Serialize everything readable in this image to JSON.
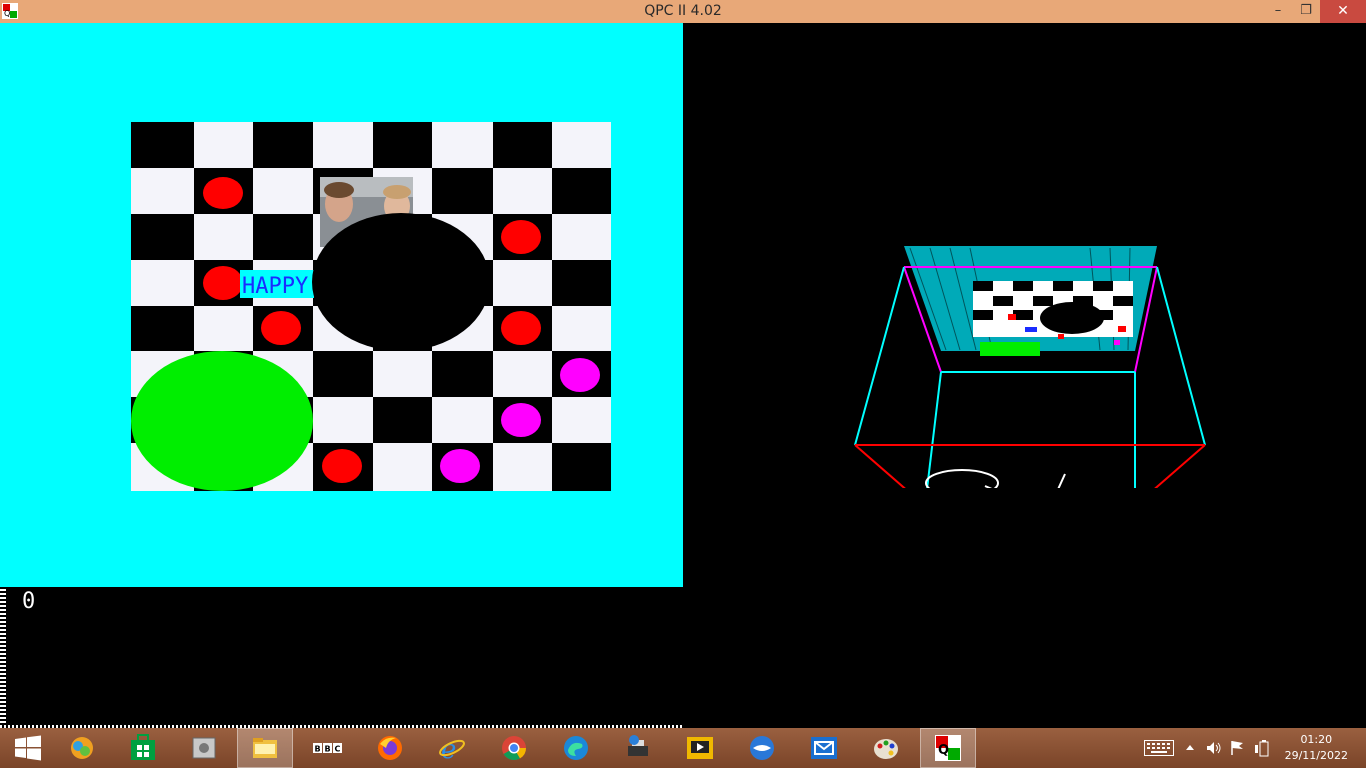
{
  "window": {
    "title": "QPC II 4.02",
    "minimize": "–",
    "restore": "❐",
    "close": "✕"
  },
  "board": {
    "happy_label": "HAPPY"
  },
  "console": {
    "line1": "0"
  },
  "scene3d": {
    "letters": "Q L"
  },
  "taskbar": {
    "apps": [
      "start",
      "photos",
      "store",
      "settings-tool",
      "file-explorer",
      "bbc",
      "firefox",
      "internet-explorer",
      "chrome",
      "edge",
      "printer-tool",
      "media-player",
      "thunderbird",
      "mail",
      "paint",
      "qpc"
    ],
    "bbc_label": "BBC",
    "active_app": "qpc"
  },
  "tray": {
    "time": "01:20",
    "date": "29/11/2022"
  },
  "colors": {
    "cyan": "#00ffff",
    "red": "#ff0000",
    "magenta": "#ff00ff",
    "green": "#00ff00",
    "titlebar": "#e8a878"
  }
}
